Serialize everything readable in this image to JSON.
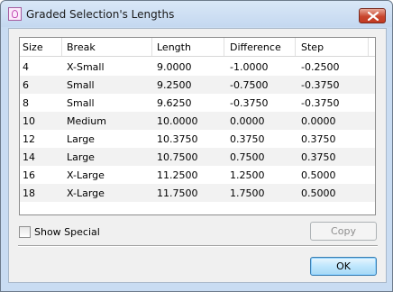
{
  "window": {
    "title": "Graded Selection's Lengths"
  },
  "table": {
    "columns": [
      "Size",
      "Break",
      "Length",
      "Difference",
      "Step"
    ],
    "rows": [
      [
        "4",
        "X-Small",
        "9.0000",
        "-1.0000",
        "-0.2500"
      ],
      [
        "6",
        "Small",
        "9.2500",
        "-0.7500",
        "-0.3750"
      ],
      [
        "8",
        "Small",
        "9.6250",
        "-0.3750",
        "-0.3750"
      ],
      [
        "10",
        "Medium",
        "10.0000",
        "0.0000",
        "0.0000"
      ],
      [
        "12",
        "Large",
        "10.3750",
        "0.3750",
        "0.3750"
      ],
      [
        "14",
        "Large",
        "10.7500",
        "0.7500",
        "0.3750"
      ],
      [
        "16",
        "X-Large",
        "11.2500",
        "1.2500",
        "0.5000"
      ],
      [
        "18",
        "X-Large",
        "11.7500",
        "1.7500",
        "0.5000"
      ]
    ]
  },
  "options": {
    "show_special_label": "Show Special",
    "show_special_checked": false
  },
  "buttons": {
    "copy_label": "Copy",
    "copy_enabled": false,
    "ok_label": "OK"
  },
  "colors": {
    "title_bar": "#c9dcf2",
    "close_button": "#c8472f",
    "ok_button": "#bee6fd"
  }
}
